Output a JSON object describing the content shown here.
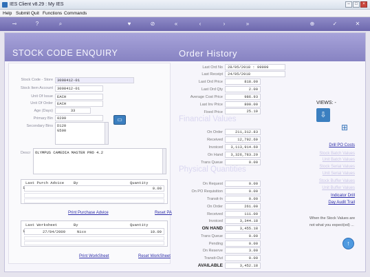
{
  "window": {
    "title": "IES Client v8.29 : My IES",
    "minimize_glyph": "–",
    "maximize_glyph": "□",
    "close_glyph": "×"
  },
  "menu": [
    "Help",
    "Submit",
    "Quit",
    "Functions",
    "Commands"
  ],
  "toolbar_icons": [
    "key-icon",
    "help-icon",
    "search-icon",
    "heart-icon",
    "stop-icon",
    "first-icon",
    "previous-icon",
    "next-icon",
    "last-icon",
    "add-icon",
    "confirm-icon",
    "close-icon"
  ],
  "sections": {
    "stock_code_enquiry": "STOCK CODE ENQUIRY",
    "order_history": "Order History",
    "financial_values": "Financial Values",
    "physical_quantities": "Physical Quantities"
  },
  "stock": {
    "stock_code_label": "Stock Code - Store",
    "stock_code": "3008412-01",
    "stock_item_account_label": "Stock Item Account",
    "stock_item_account": "3008412-01",
    "unit_of_issue_label": "Unit Of Issue",
    "unit_of_issue": "EACH",
    "unit_of_order_label": "Unit Of Order",
    "unit_of_order": "EACH",
    "age_label": "Age (Days)",
    "age": "33",
    "primary_bin_label": "Primary Bin",
    "primary_bin": "0209",
    "secondary_bins_label": "Secondary Bins",
    "secondary_bins": [
      "D120",
      "G500"
    ],
    "descr_label": "Descr",
    "description": "OLYMPUS CAMEDIA MASTER PRO 4.2"
  },
  "purchase_advice": {
    "columns": [
      "Last Purch Advice",
      "By",
      "Quantity"
    ],
    "row_number": "1",
    "quantity": "0.00",
    "print_link": "Print Purchase Advice",
    "reset_link": "Reset PA"
  },
  "worksheet": {
    "columns": [
      "Last Worksheet",
      "By",
      "Quantity"
    ],
    "row_number": "1",
    "date": "27/04/2009",
    "by": "Nico",
    "quantity": "10.00",
    "print_link": "Print WorkSheet",
    "reset_link": "Reset WorkSheet"
  },
  "order_history": [
    {
      "label": "Last Ord No",
      "value": "28/05/2018 : 99999"
    },
    {
      "label": "Last Receipt",
      "value": "24/05/2018"
    },
    {
      "label": "Last Ord Price",
      "value": "818.00"
    },
    {
      "label": "Last Ord Qty",
      "value": "2.00"
    },
    {
      "label": "Average Cost Price",
      "value": "986.93"
    },
    {
      "label": "Last Inv Price",
      "value": "800.00"
    },
    {
      "label": "Fixed Price",
      "value": "25.10"
    }
  ],
  "financial_values": [
    {
      "label": "On Order",
      "value": "211,312.83"
    },
    {
      "label": "Received",
      "value": "12,792.69"
    },
    {
      "label": "Invoiced",
      "value": "3,113,914.69"
    },
    {
      "label": "On Hand",
      "value": "3,326,783.29"
    },
    {
      "label": "Trans Queue",
      "value": "0.00"
    }
  ],
  "physical_quantities": [
    {
      "label": "On Request",
      "value": "0.00",
      "bold": false
    },
    {
      "label": "On PO Requisition",
      "value": "0.00",
      "bold": false
    },
    {
      "label": "Transit-In",
      "value": "0.00",
      "bold": false
    },
    {
      "label": "On Order",
      "value": "261.00",
      "bold": false
    },
    {
      "label": "Received",
      "value": "111.00",
      "bold": false
    },
    {
      "label": "Invoiced",
      "value": "3,344.18",
      "bold": false
    },
    {
      "label": "ON HAND",
      "value": "3,455.18",
      "bold": true
    },
    {
      "label": "Trans Queue",
      "value": "0.00",
      "bold": false
    },
    {
      "label": "Pending",
      "value": "0.00",
      "bold": false
    },
    {
      "label": "On Reserve",
      "value": "3.00",
      "bold": false
    },
    {
      "label": "Transit-Out",
      "value": "0.00",
      "bold": false
    },
    {
      "label": "AVAILABLE",
      "value": "3,452.18",
      "bold": true
    }
  ],
  "views": {
    "title": "VIEWS: -",
    "links": [
      {
        "label": "Drill PO Costs",
        "faint": false
      },
      {
        "label": "Stock Batch Values",
        "faint": true
      },
      {
        "label": "Unit Batch Values",
        "faint": true
      },
      {
        "label": "Stock Serial Values",
        "faint": true
      },
      {
        "label": "Unit Serial Values",
        "faint": true
      },
      {
        "label": "Stock Buffer Values",
        "faint": true
      },
      {
        "label": "Unit Buffer Values",
        "faint": true
      },
      {
        "label": "Indicator Drill",
        "faint": false
      },
      {
        "label": "Day Audit Trail",
        "faint": false
      }
    ],
    "hint": [
      "When the Stock Values are",
      "not what you expect(ed) ..."
    ]
  }
}
